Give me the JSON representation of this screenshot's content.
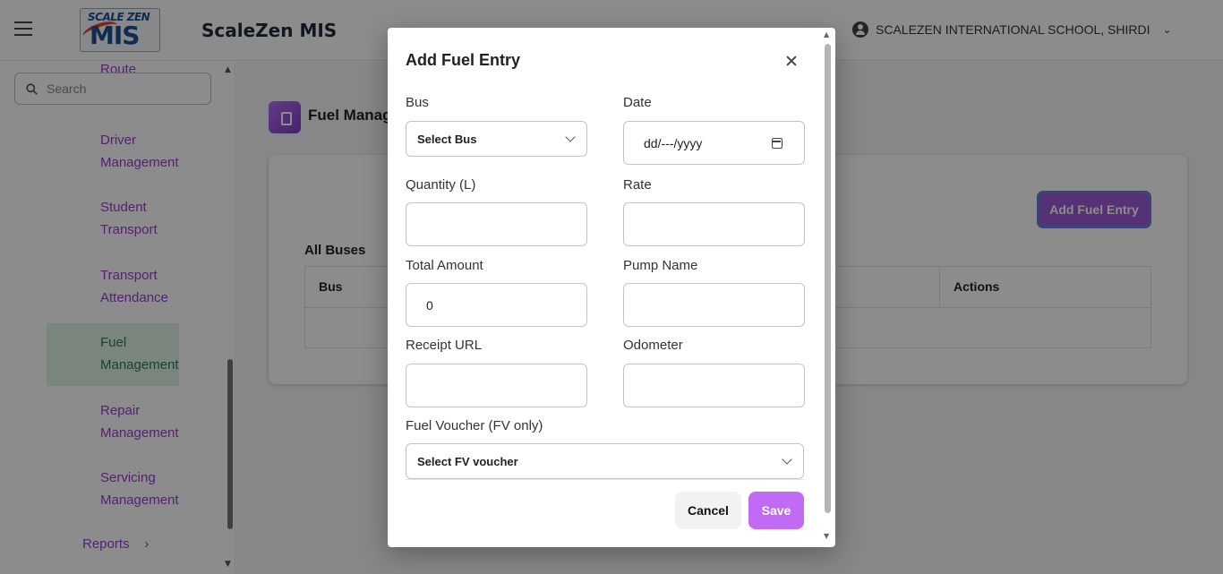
{
  "header": {
    "logo_top": "SCALE ZEN",
    "logo_main": "MIS",
    "app_title": "ScaleZen MIS",
    "school_name": "SCALEZEN INTERNATIONAL SCHOOL, SHIRDI"
  },
  "sidebar": {
    "search_placeholder": "Search",
    "partial_item": "Route",
    "items": [
      {
        "line1": "Driver",
        "line2": "Management"
      },
      {
        "line1": "Student",
        "line2": "Transport"
      },
      {
        "line1": "Transport",
        "line2": "Attendance"
      },
      {
        "line1": "Fuel",
        "line2": "Management"
      },
      {
        "line1": "Repair",
        "line2": "Management"
      },
      {
        "line1": "Servicing",
        "line2": "Management"
      }
    ],
    "reports": "Reports",
    "reports_arrow": "›"
  },
  "main": {
    "page_title": "Fuel Manag",
    "add_button": "Add Fuel Entry",
    "table_title": "All Buses",
    "columns": [
      "Bus",
      "Actions"
    ]
  },
  "modal": {
    "title": "Add Fuel Entry",
    "labels": {
      "bus": "Bus",
      "date": "Date",
      "quantity": "Quantity (L)",
      "rate": "Rate",
      "total_amount": "Total Amount",
      "pump_name": "Pump Name",
      "receipt_url": "Receipt URL",
      "odometer": "Odometer",
      "fuel_voucher": "Fuel Voucher (FV only)"
    },
    "values": {
      "bus_select": "Select Bus",
      "date_placeholder": "dd/---/yyyy",
      "total_amount": "0",
      "fuel_voucher_select": "Select FV voucher"
    },
    "buttons": {
      "cancel": "Cancel",
      "save": "Save"
    }
  }
}
